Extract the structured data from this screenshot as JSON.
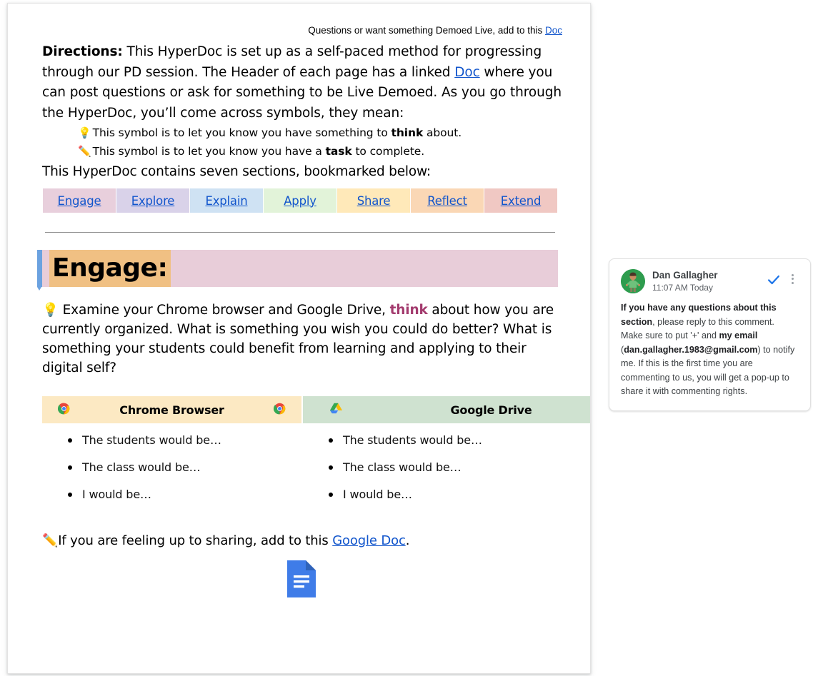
{
  "page": {
    "header_note": "Questions or want something Demoed Live, add to this",
    "header_link": "Doc"
  },
  "directions": {
    "label": "Directions:",
    "text_part1": " This HyperDoc is set up as a self-paced method for progressing through our PD session. The Header of each page has a linked ",
    "link": "Doc",
    "text_part2": " where you can post questions or ask for something to be Live Demoed. As you go through the HyperDoc, you’ll come across symbols, they mean:",
    "symbols": [
      {
        "icon": "💡",
        "icon_name": "lightbulb-emoji",
        "text_before": "This symbol is to let you know you have something to ",
        "bold": "think",
        "text_after": " about."
      },
      {
        "icon": "✏️",
        "icon_name": "pencil-emoji",
        "text_before": "This symbol is to let you know you have a ",
        "bold": "task",
        "text_after": " to complete."
      }
    ],
    "contains_line": "This HyperDoc contains seven sections, bookmarked below:"
  },
  "nav": {
    "items": [
      {
        "label": "Engage",
        "color": "#e8cfdc"
      },
      {
        "label": "Explore",
        "color": "#d9d2e9"
      },
      {
        "label": "Explain",
        "color": "#cfe2f3"
      },
      {
        "label": "Apply",
        "color": "#e2f3d9"
      },
      {
        "label": "Share",
        "color": "#ffe9b9"
      },
      {
        "label": "Reflect",
        "color": "#fad7b5"
      },
      {
        "label": "Extend",
        "color": "#f0c8c3"
      }
    ]
  },
  "engage": {
    "title": "Engage:",
    "title_highlight": "#f0c083",
    "banner_color": "#e8cdd9",
    "anchor_color": "#6ba2e0",
    "paragraph": {
      "icon": "💡",
      "icon_name": "lightbulb-emoji",
      "before": "Examine your Chrome browser and Google Drive, ",
      "emphasis": "think",
      "emphasis_color": "#a33b6e",
      "after": " about how you are currently organized. What is something you wish you could do better? What is something your students could benefit from learning and applying to their digital self?"
    }
  },
  "table": {
    "columns": [
      {
        "header": "Chrome Browser",
        "header_color": "#fce9c3",
        "icon_name": "chrome-icon",
        "items": [
          "The students would be…",
          "The class would be…",
          "I would be…"
        ]
      },
      {
        "header": "Google Drive",
        "header_color": "#cfe2d0",
        "icon_name": "google-drive-icon",
        "items": [
          "The students would be…",
          "The class would be…",
          "I would be…"
        ]
      }
    ]
  },
  "closing": {
    "icon": "✏️",
    "icon_name": "pencil-emoji",
    "before": "If you are feeling up to sharing, add to this ",
    "link": "Google Doc",
    "after": ".",
    "doc_icon_name": "google-docs-icon",
    "doc_icon_color": "#3f7ce8"
  },
  "comment": {
    "author": "Dan Gallagher",
    "timestamp": "11:07 AM Today",
    "resolve_icon": "resolve-checkmark-icon",
    "resolve_color": "#1a73e8",
    "menu_icon": "more-options-icon",
    "avatar_name": "user-avatar",
    "body": {
      "bold1": "If you have any questions about this section",
      "t1": ", please reply to this comment. Make sure to put '+' and ",
      "bold2": "my email",
      "t2": " (",
      "bold3": "dan.gallagher.1983@gmail.com",
      "t3": ") to notify me. If this is the first time you are commenting to us, you will get a pop-up to share it with commenting rights."
    }
  }
}
